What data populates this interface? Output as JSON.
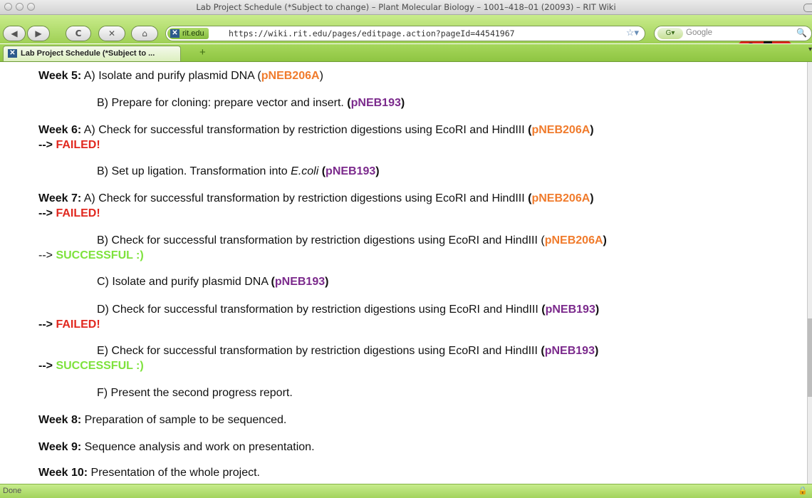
{
  "window": {
    "title": "Lab Project Schedule (*Subject to change) – Plant Molecular Biology – 1001–418–01 (20093) – RIT Wiki"
  },
  "toolbar": {
    "back_glyph": "◀",
    "forward_glyph": "▶",
    "reload_glyph": "C",
    "stop_glyph": "✕",
    "home_glyph": "⌂",
    "site_label": "rit.edu",
    "url": "https://wiki.rit.edu/pages/editpage.action?pageId=44541967",
    "search_placeholder": "Google",
    "bookmark_glyph": "☆▾"
  },
  "tab": {
    "label": "Lab Project Schedule (*Subject to ...",
    "new_tab": "+"
  },
  "content": {
    "w5a": {
      "week": "Week 5:",
      "text": " A) Isolate and purify plasmid DNA (",
      "vec": "pNEB206A",
      "close": ")"
    },
    "w5b": {
      "text": "B) Prepare for cloning: prepare vector and insert. ",
      "open": "(",
      "vec": "pNEB193",
      "close": ")"
    },
    "w6a": {
      "week": "Week 6:",
      "text": " A) Check for successful transformation by restriction digestions using EcoRI and HindIII ",
      "open": "(",
      "vec": "pNEB206A",
      "close": ")"
    },
    "w6a_result": {
      "arrow": "-->",
      "status": " FAILED!"
    },
    "w6b": {
      "text": "B) Set up ligation. Transformation into ",
      "organism": "E.coli",
      "open": " (",
      "vec": "pNEB193",
      "close": ")"
    },
    "w7a": {
      "week": "Week 7:",
      "text": " A) Check for successful transformation by restriction digestions using EcoRI and HindIII ",
      "open": "(",
      "vec": "pNEB206A",
      "close": ")"
    },
    "w7a_result": {
      "arrow": "-->",
      "status": " FAILED!"
    },
    "w7b": {
      "text": "B) Check for successful transformation by restriction digestions using EcoRI and HindIII (",
      "vec": "pNEB206A",
      "close": ")"
    },
    "w7b_result": {
      "arrow": "-->",
      "status": " SUCCESSFUL :)"
    },
    "w7c": {
      "text": "C) Isolate and purify plasmid DNA ",
      "open": "(",
      "vec": "pNEB193",
      "close": ")"
    },
    "w7d": {
      "text": "D) Check for successful transformation by restriction digestions using EcoRI and HindIII ",
      "open": "(",
      "vec": "pNEB193",
      "close": ")"
    },
    "w7d_result": {
      "arrow": "-->",
      "status": " FAILED!"
    },
    "w7e": {
      "text": "E) Check for successful transformation by restriction digestions using EcoRI and HindIII ",
      "open": "(",
      "vec": "pNEB193",
      "close": ")"
    },
    "w7e_result": {
      "arrow": "-->",
      "status": " SUCCESSFUL :)"
    },
    "w7f": {
      "text": "F) Present the second progress report."
    },
    "w8": {
      "week": "Week 8:",
      "text": " Preparation of sample to be sequenced."
    },
    "w9": {
      "week": "Week 9:",
      "text": " Sequence analysis and work on presentation."
    },
    "w10": {
      "week": "Week 10:",
      "text": " Presentation of the whole project."
    }
  },
  "status": {
    "text": "Done",
    "lock_glyph": "🔒"
  },
  "colors": {
    "toolbar_green": "#a6d75c",
    "vector_orange": "#f07b2c",
    "vector_purple": "#7b2a8c",
    "failed_red": "#e1281f",
    "success_green": "#7ee23c"
  }
}
